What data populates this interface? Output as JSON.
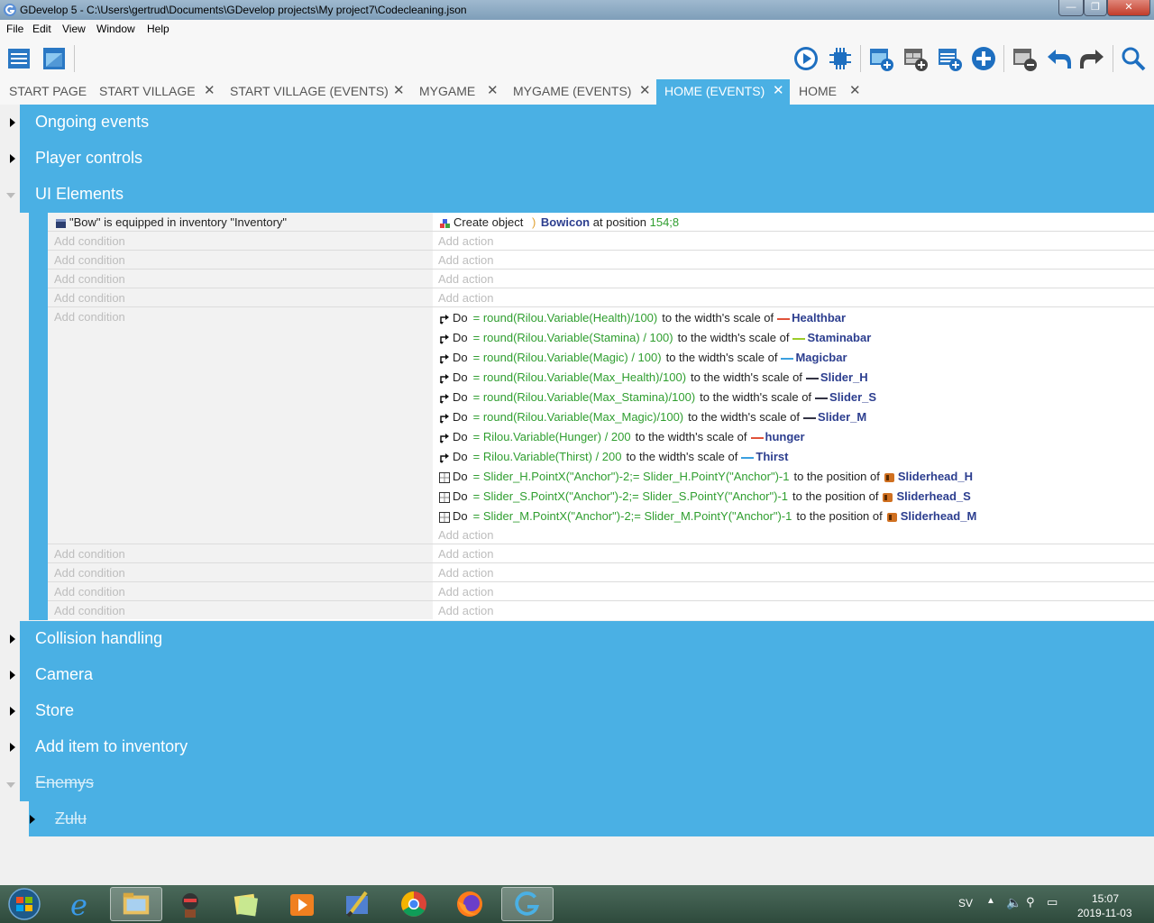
{
  "window": {
    "title": "GDevelop 5 - C:\\Users\\gertrud\\Documents\\GDevelop projects\\My project7\\Codecleaning.json",
    "minimize": "—",
    "maximize": "❐",
    "close": "✕"
  },
  "menu": [
    "File",
    "Edit",
    "View",
    "Window",
    "Help"
  ],
  "tabs": [
    {
      "label": "START PAGE",
      "closable": false
    },
    {
      "label": "START VILLAGE",
      "closable": true
    },
    {
      "label": "START VILLAGE (EVENTS)",
      "closable": true
    },
    {
      "label": "MYGAME",
      "closable": true
    },
    {
      "label": "MYGAME (EVENTS)",
      "closable": true
    },
    {
      "label": "HOME (EVENTS)",
      "closable": true,
      "active": true
    },
    {
      "label": "HOME",
      "closable": true
    }
  ],
  "tab_close_glyph": "✕",
  "groups": {
    "ongoing": "Ongoing events",
    "player": "Player controls",
    "ui": "UI Elements",
    "collision": "Collision handling",
    "camera": "Camera",
    "store": "Store",
    "additem": "Add item to inventory",
    "enemys": "Enemys",
    "zulu": "Zulu"
  },
  "placeholders": {
    "condition": "Add condition",
    "action": "Add action"
  },
  "event1": {
    "condition": "\"Bow\" is equipped in inventory \"Inventory\"",
    "action_prefix": "Create object",
    "action_object": "Bowicon",
    "action_mid": "at position",
    "action_pos": "154;8"
  },
  "do_label": "Do",
  "actions": [
    {
      "expr": "= round(Rilou.Variable(Health)/100)",
      "mid": "to the width's scale of",
      "obj": "Healthbar",
      "color": "#e0523a",
      "kind": "scale"
    },
    {
      "expr": "= round(Rilou.Variable(Stamina) / 100)",
      "mid": "to the width's scale of",
      "obj": "Staminabar",
      "color": "#9ccc2a",
      "kind": "scale"
    },
    {
      "expr": "= round(Rilou.Variable(Magic) / 100)",
      "mid": "to the width's scale of",
      "obj": "Magicbar",
      "color": "#3aa0e0",
      "kind": "scale"
    },
    {
      "expr": "= round(Rilou.Variable(Max_Health)/100)",
      "mid": "to the width's scale of",
      "obj": "Slider_H",
      "color": "#333344",
      "kind": "scale"
    },
    {
      "expr": "= round(Rilou.Variable(Max_Stamina)/100)",
      "mid": "to the width's scale of",
      "obj": "Slider_S",
      "color": "#333344",
      "kind": "scale"
    },
    {
      "expr": "= round(Rilou.Variable(Max_Magic)/100)",
      "mid": "to the width's scale of",
      "obj": "Slider_M",
      "color": "#333344",
      "kind": "scale"
    },
    {
      "expr": "= Rilou.Variable(Hunger) / 200",
      "mid": "to the width's scale of",
      "obj": "hunger",
      "color": "#e0523a",
      "kind": "scale"
    },
    {
      "expr": "= Rilou.Variable(Thirst) / 200",
      "mid": "to the width's scale of",
      "obj": "Thirst",
      "color": "#3aa0e0",
      "kind": "scale"
    },
    {
      "expr": "= Slider_H.PointX(\"Anchor\")-2;= Slider_H.PointY(\"Anchor\")-1",
      "mid": "to the position of",
      "obj": "Sliderhead_H",
      "color": "#d07020",
      "kind": "position"
    },
    {
      "expr": "= Slider_S.PointX(\"Anchor\")-2;= Slider_S.PointY(\"Anchor\")-1",
      "mid": "to the position of",
      "obj": "Sliderhead_S",
      "color": "#d07020",
      "kind": "position"
    },
    {
      "expr": "= Slider_M.PointX(\"Anchor\")-2;= Slider_M.PointY(\"Anchor\")-1",
      "mid": "to the position of",
      "obj": "Sliderhead_M",
      "color": "#d07020",
      "kind": "position"
    }
  ],
  "taskbar": {
    "language": "SV",
    "time": "15:07",
    "date": "2019-11-03"
  },
  "colors": {
    "accent": "#4ab0e4",
    "expression": "#2f9e2f",
    "object": "#2c3e8f"
  }
}
